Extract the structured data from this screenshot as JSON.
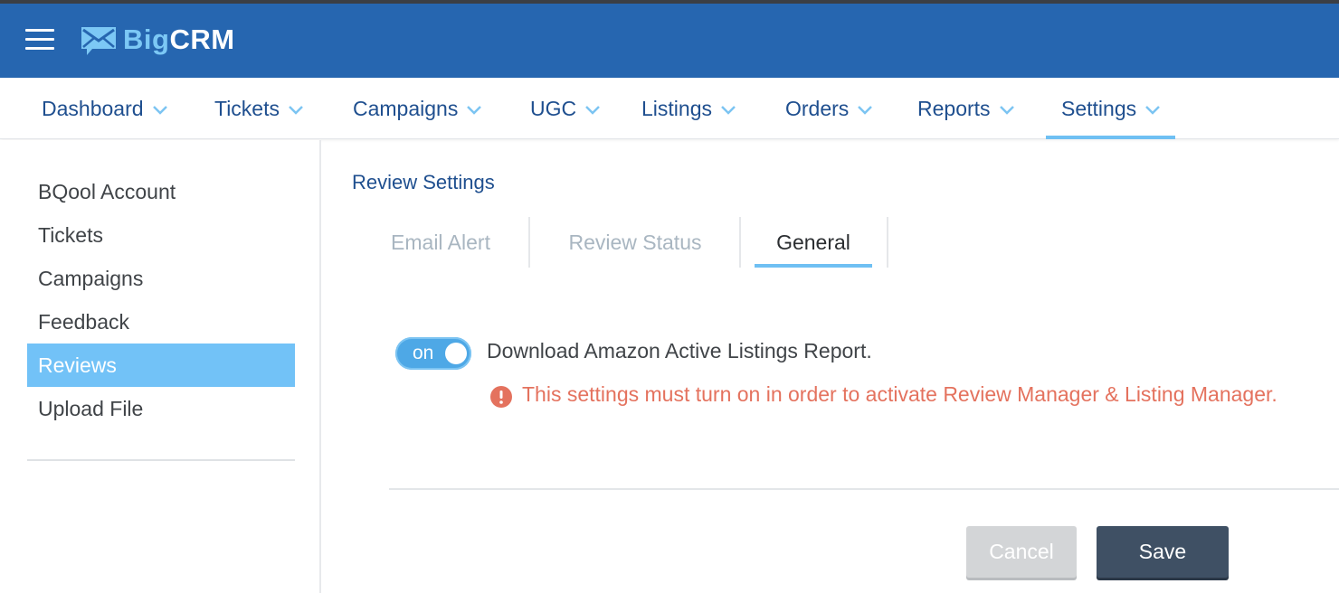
{
  "app": {
    "logo_part1": "Big",
    "logo_part2": "CRM",
    "brand_color": "#2666b0",
    "accent_color": "#6fc0f3"
  },
  "nav": {
    "items": [
      {
        "label": "Dashboard"
      },
      {
        "label": "Tickets"
      },
      {
        "label": "Campaigns"
      },
      {
        "label": "UGC"
      },
      {
        "label": "Listings"
      },
      {
        "label": "Orders"
      },
      {
        "label": "Reports"
      },
      {
        "label": "Settings",
        "active": true
      }
    ]
  },
  "sidebar": {
    "items": [
      {
        "label": "BQool Account"
      },
      {
        "label": "Tickets"
      },
      {
        "label": "Campaigns"
      },
      {
        "label": "Feedback"
      },
      {
        "label": "Reviews",
        "active": true
      },
      {
        "label": "Upload File"
      }
    ]
  },
  "main": {
    "title": "Review Settings",
    "tabs": [
      {
        "label": "Email Alert"
      },
      {
        "label": "Review Status"
      },
      {
        "label": "General",
        "active": true
      }
    ],
    "setting": {
      "toggle_label": "on",
      "toggle_state": true,
      "label": "Download Amazon Active Listings Report.",
      "warning": "This settings must turn on in order to activate Review Manager & Listing Manager.",
      "warning_color": "#e4725e"
    },
    "buttons": {
      "cancel": "Cancel",
      "save": "Save"
    }
  }
}
